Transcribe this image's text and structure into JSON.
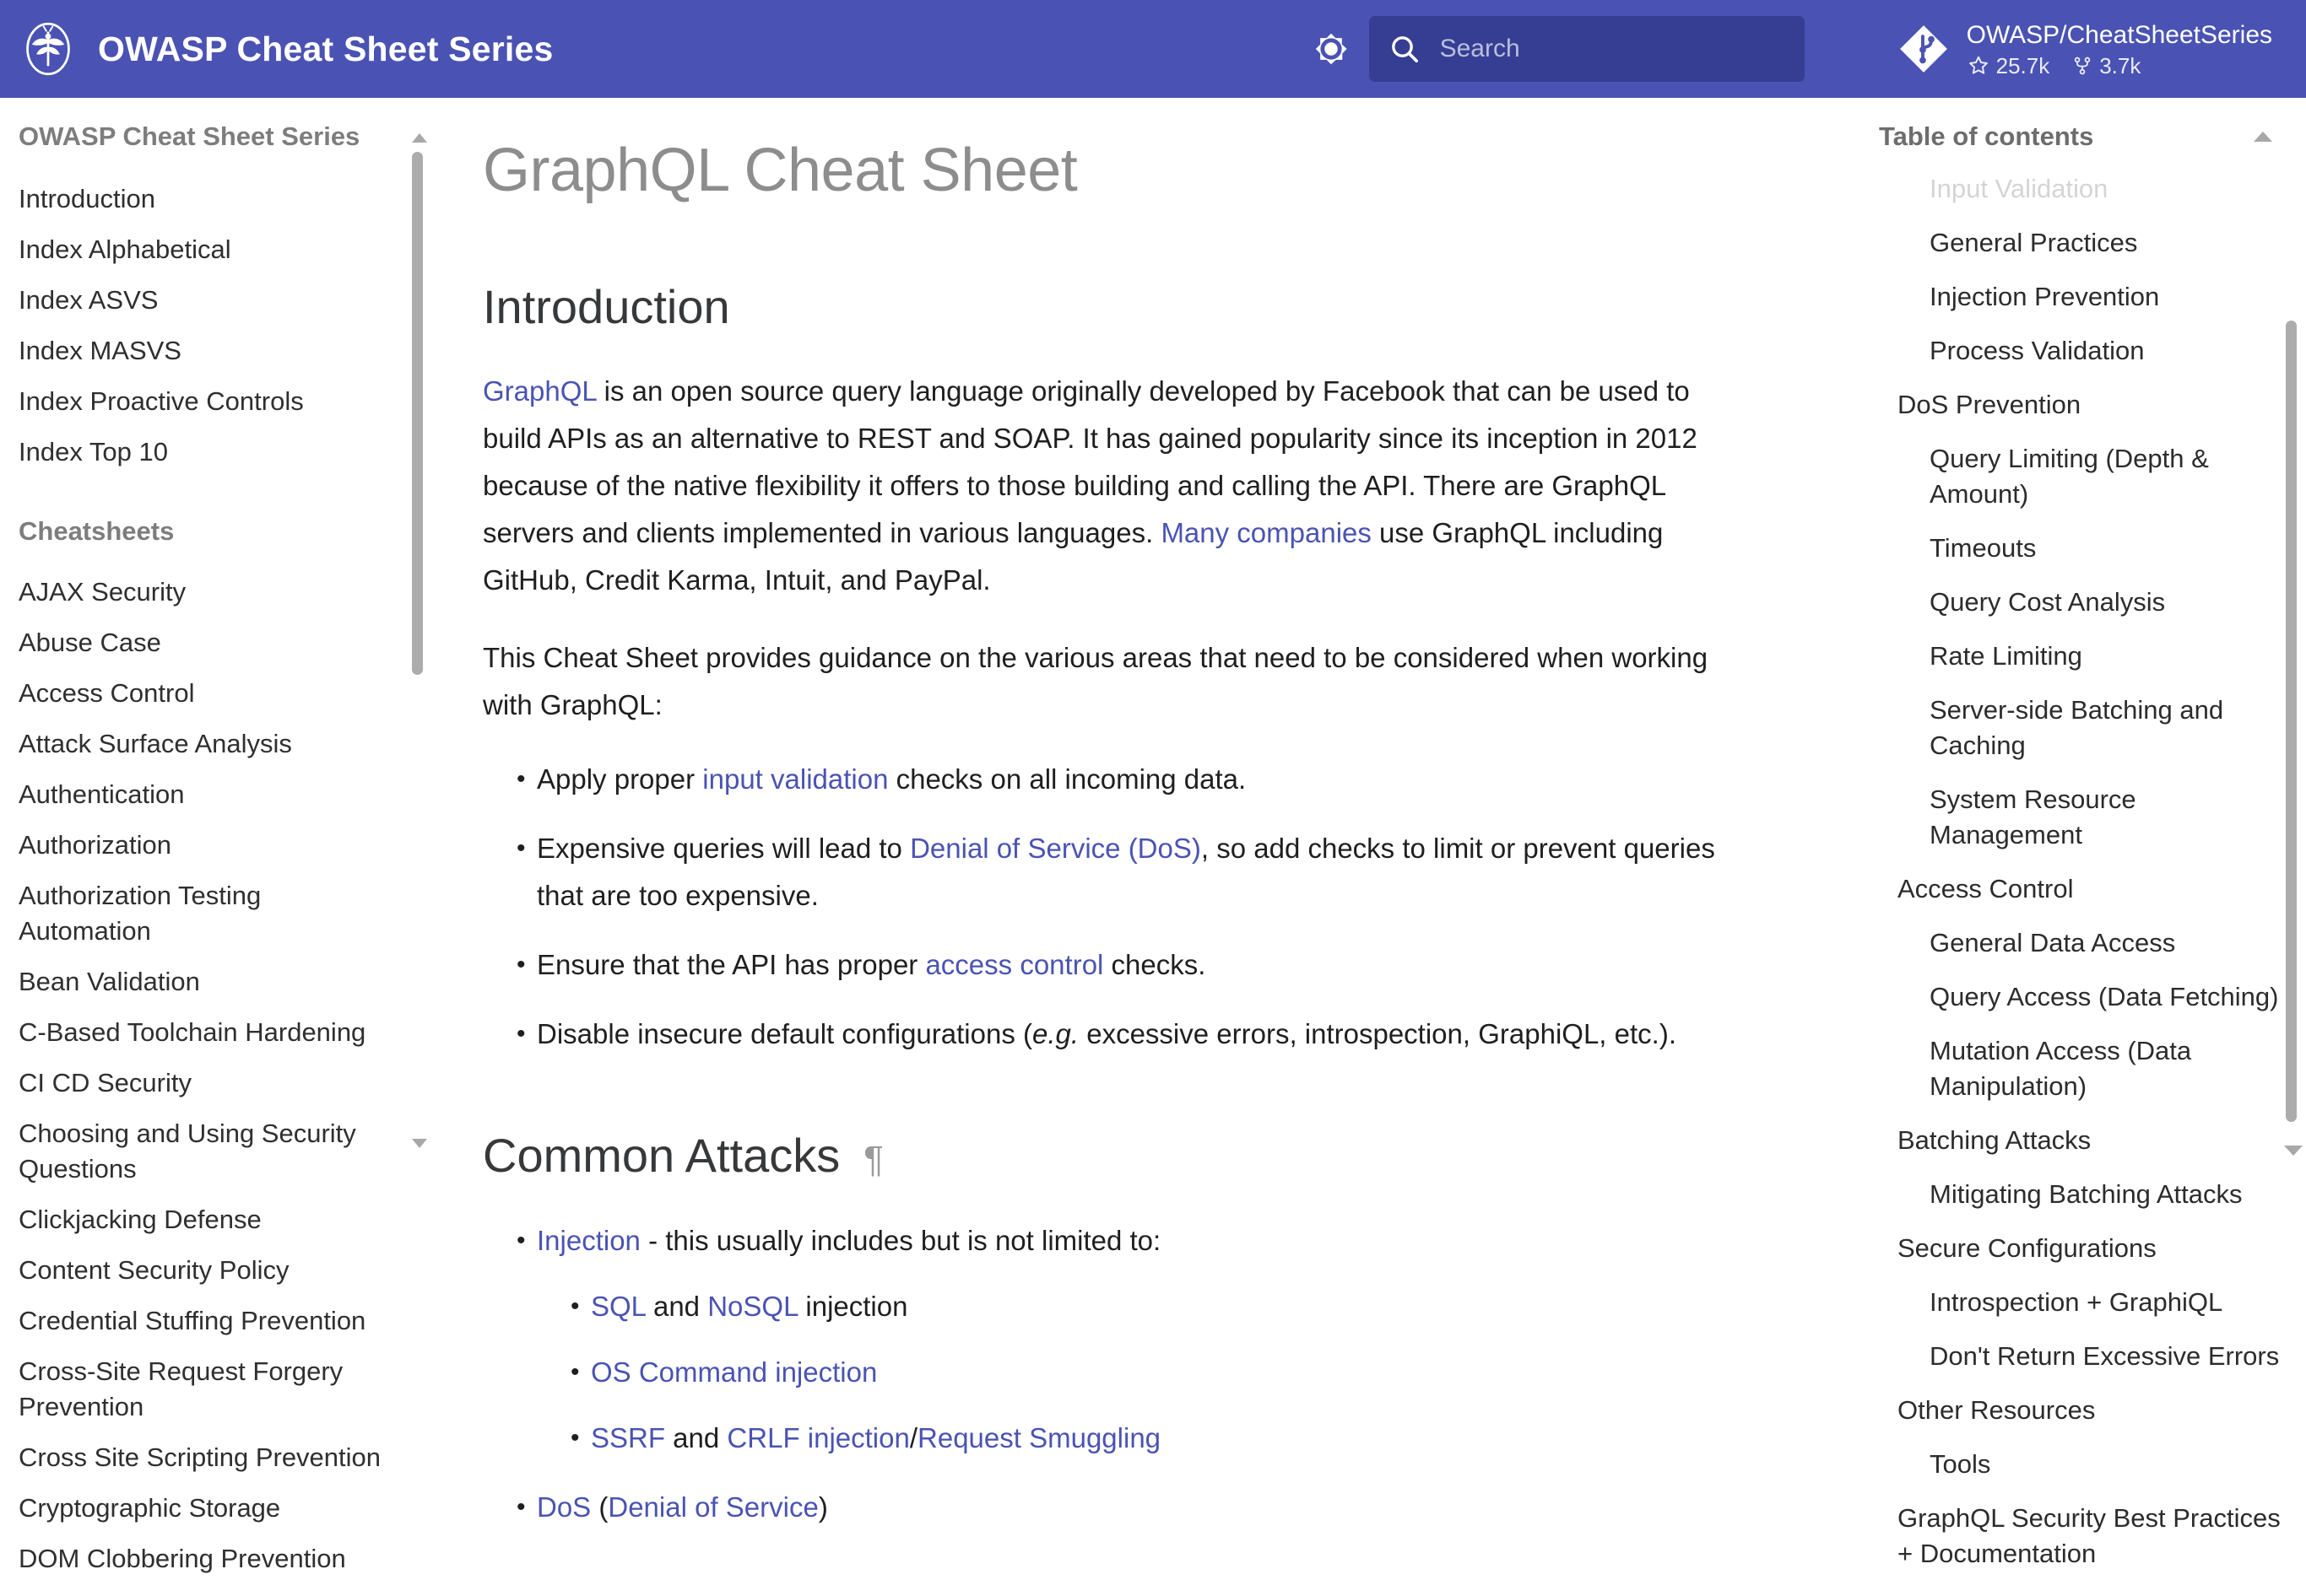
{
  "header": {
    "logo_icon": "owasp-dragonfly-logo",
    "title": "OWASP Cheat Sheet Series",
    "theme_toggle_icon": "brightness-sun-icon",
    "search": {
      "icon": "search-icon",
      "placeholder": "Search",
      "value": ""
    },
    "repo": {
      "icon": "git-logo-icon",
      "name": "OWASP/CheatSheetSeries",
      "stars_icon": "star-icon",
      "stars": "25.7k",
      "forks_icon": "fork-icon",
      "forks": "3.7k"
    },
    "accent_color": "#4a53b3",
    "search_bg_color": "#363e93"
  },
  "sidebar": {
    "title": "OWASP Cheat Sheet Series",
    "top_items": [
      "Introduction",
      "Index Alphabetical",
      "Index ASVS",
      "Index MASVS",
      "Index Proactive Controls",
      "Index Top 10"
    ],
    "section_label": "Cheatsheets",
    "cheatsheets": [
      "AJAX Security",
      "Abuse Case",
      "Access Control",
      "Attack Surface Analysis",
      "Authentication",
      "Authorization",
      "Authorization Testing Automation",
      "Bean Validation",
      "C-Based Toolchain Hardening",
      "CI CD Security",
      "Choosing and Using Security Questions",
      "Clickjacking Defense",
      "Content Security Policy",
      "Credential Stuffing Prevention",
      "Cross-Site Request Forgery Prevention",
      "Cross Site Scripting Prevention",
      "Cryptographic Storage",
      "DOM Clobbering Prevention"
    ],
    "scrollbar": {
      "up_arrow_icon": "chevron-up-icon",
      "down_arrow_icon": "chevron-down-icon"
    }
  },
  "main": {
    "page_title": "GraphQL Cheat Sheet",
    "intro_heading": "Introduction",
    "intro_p1": {
      "link_graphql": "GraphQL",
      "text_a": " is an open source query language originally developed by Facebook that can be used to build APIs as an alternative to REST and SOAP. It has gained popularity since its inception in 2012 because of the native flexibility it offers to those building and calling the API. There are GraphQL servers and clients implemented in various languages. ",
      "link_companies": "Many companies",
      "text_b": " use GraphQL including GitHub, Credit Karma, Intuit, and PayPal."
    },
    "intro_p2": "This Cheat Sheet provides guidance on the various areas that need to be considered when working with GraphQL:",
    "intro_bullets": [
      {
        "pre": "Apply proper ",
        "link": "input validation",
        "post": " checks on all incoming data."
      },
      {
        "pre": "Expensive queries will lead to ",
        "link": "Denial of Service (DoS)",
        "post": ", so add checks to limit or prevent queries that are too expensive."
      },
      {
        "pre": "Ensure that the API has proper ",
        "link": "access control",
        "post": " checks."
      },
      {
        "pre": "Disable insecure default configurations (",
        "italic": "e.g.",
        "post": " excessive errors, introspection, GraphiQL, etc.)."
      }
    ],
    "attacks_heading": "Common Attacks",
    "attacks_anchor": "¶",
    "attack_injection": {
      "link": "Injection",
      "post": " - this usually includes but is not limited to:"
    },
    "attack_sub": [
      {
        "link_a": "SQL",
        "mid": " and ",
        "link_b": "NoSQL",
        "post": " injection"
      },
      {
        "link_a": "OS Command injection"
      },
      {
        "link_a": "SSRF",
        "mid": " and ",
        "link_b": "CRLF injection",
        "link_c": "Request Smuggling",
        "sep": "/"
      }
    ],
    "attack_dos": {
      "link_a": "DoS",
      "open": " (",
      "link_b": "Denial of Service",
      "close": ")"
    }
  },
  "toc": {
    "title": "Table of contents",
    "faded_item": "Input Validation",
    "items": [
      {
        "label": "General Practices",
        "level": 2
      },
      {
        "label": "Injection Prevention",
        "level": 2
      },
      {
        "label": "Process Validation",
        "level": 2
      },
      {
        "label": "DoS Prevention",
        "level": 1
      },
      {
        "label": "Query Limiting (Depth & Amount)",
        "level": 2
      },
      {
        "label": "Timeouts",
        "level": 2
      },
      {
        "label": "Query Cost Analysis",
        "level": 2
      },
      {
        "label": "Rate Limiting",
        "level": 2
      },
      {
        "label": "Server-side Batching and Caching",
        "level": 2
      },
      {
        "label": "System Resource Management",
        "level": 2
      },
      {
        "label": "Access Control",
        "level": 1
      },
      {
        "label": "General Data Access",
        "level": 2
      },
      {
        "label": "Query Access (Data Fetching)",
        "level": 2
      },
      {
        "label": "Mutation Access (Data Manipulation)",
        "level": 2
      },
      {
        "label": "Batching Attacks",
        "level": 1
      },
      {
        "label": "Mitigating Batching Attacks",
        "level": 2
      },
      {
        "label": "Secure Configurations",
        "level": 1
      },
      {
        "label": "Introspection + GraphiQL",
        "level": 2
      },
      {
        "label": "Don't Return Excessive Errors",
        "level": 2
      },
      {
        "label": "Other Resources",
        "level": 1
      },
      {
        "label": "Tools",
        "level": 2
      },
      {
        "label": "GraphQL Security Best Practices + Documentation",
        "level": 1
      }
    ],
    "up_arrow_icon": "chevron-up-icon",
    "down_arrow_icon": "chevron-down-icon"
  },
  "colors": {
    "link": "#4a53b3",
    "text": "#1f1f20",
    "muted": "#7d7d7d"
  }
}
